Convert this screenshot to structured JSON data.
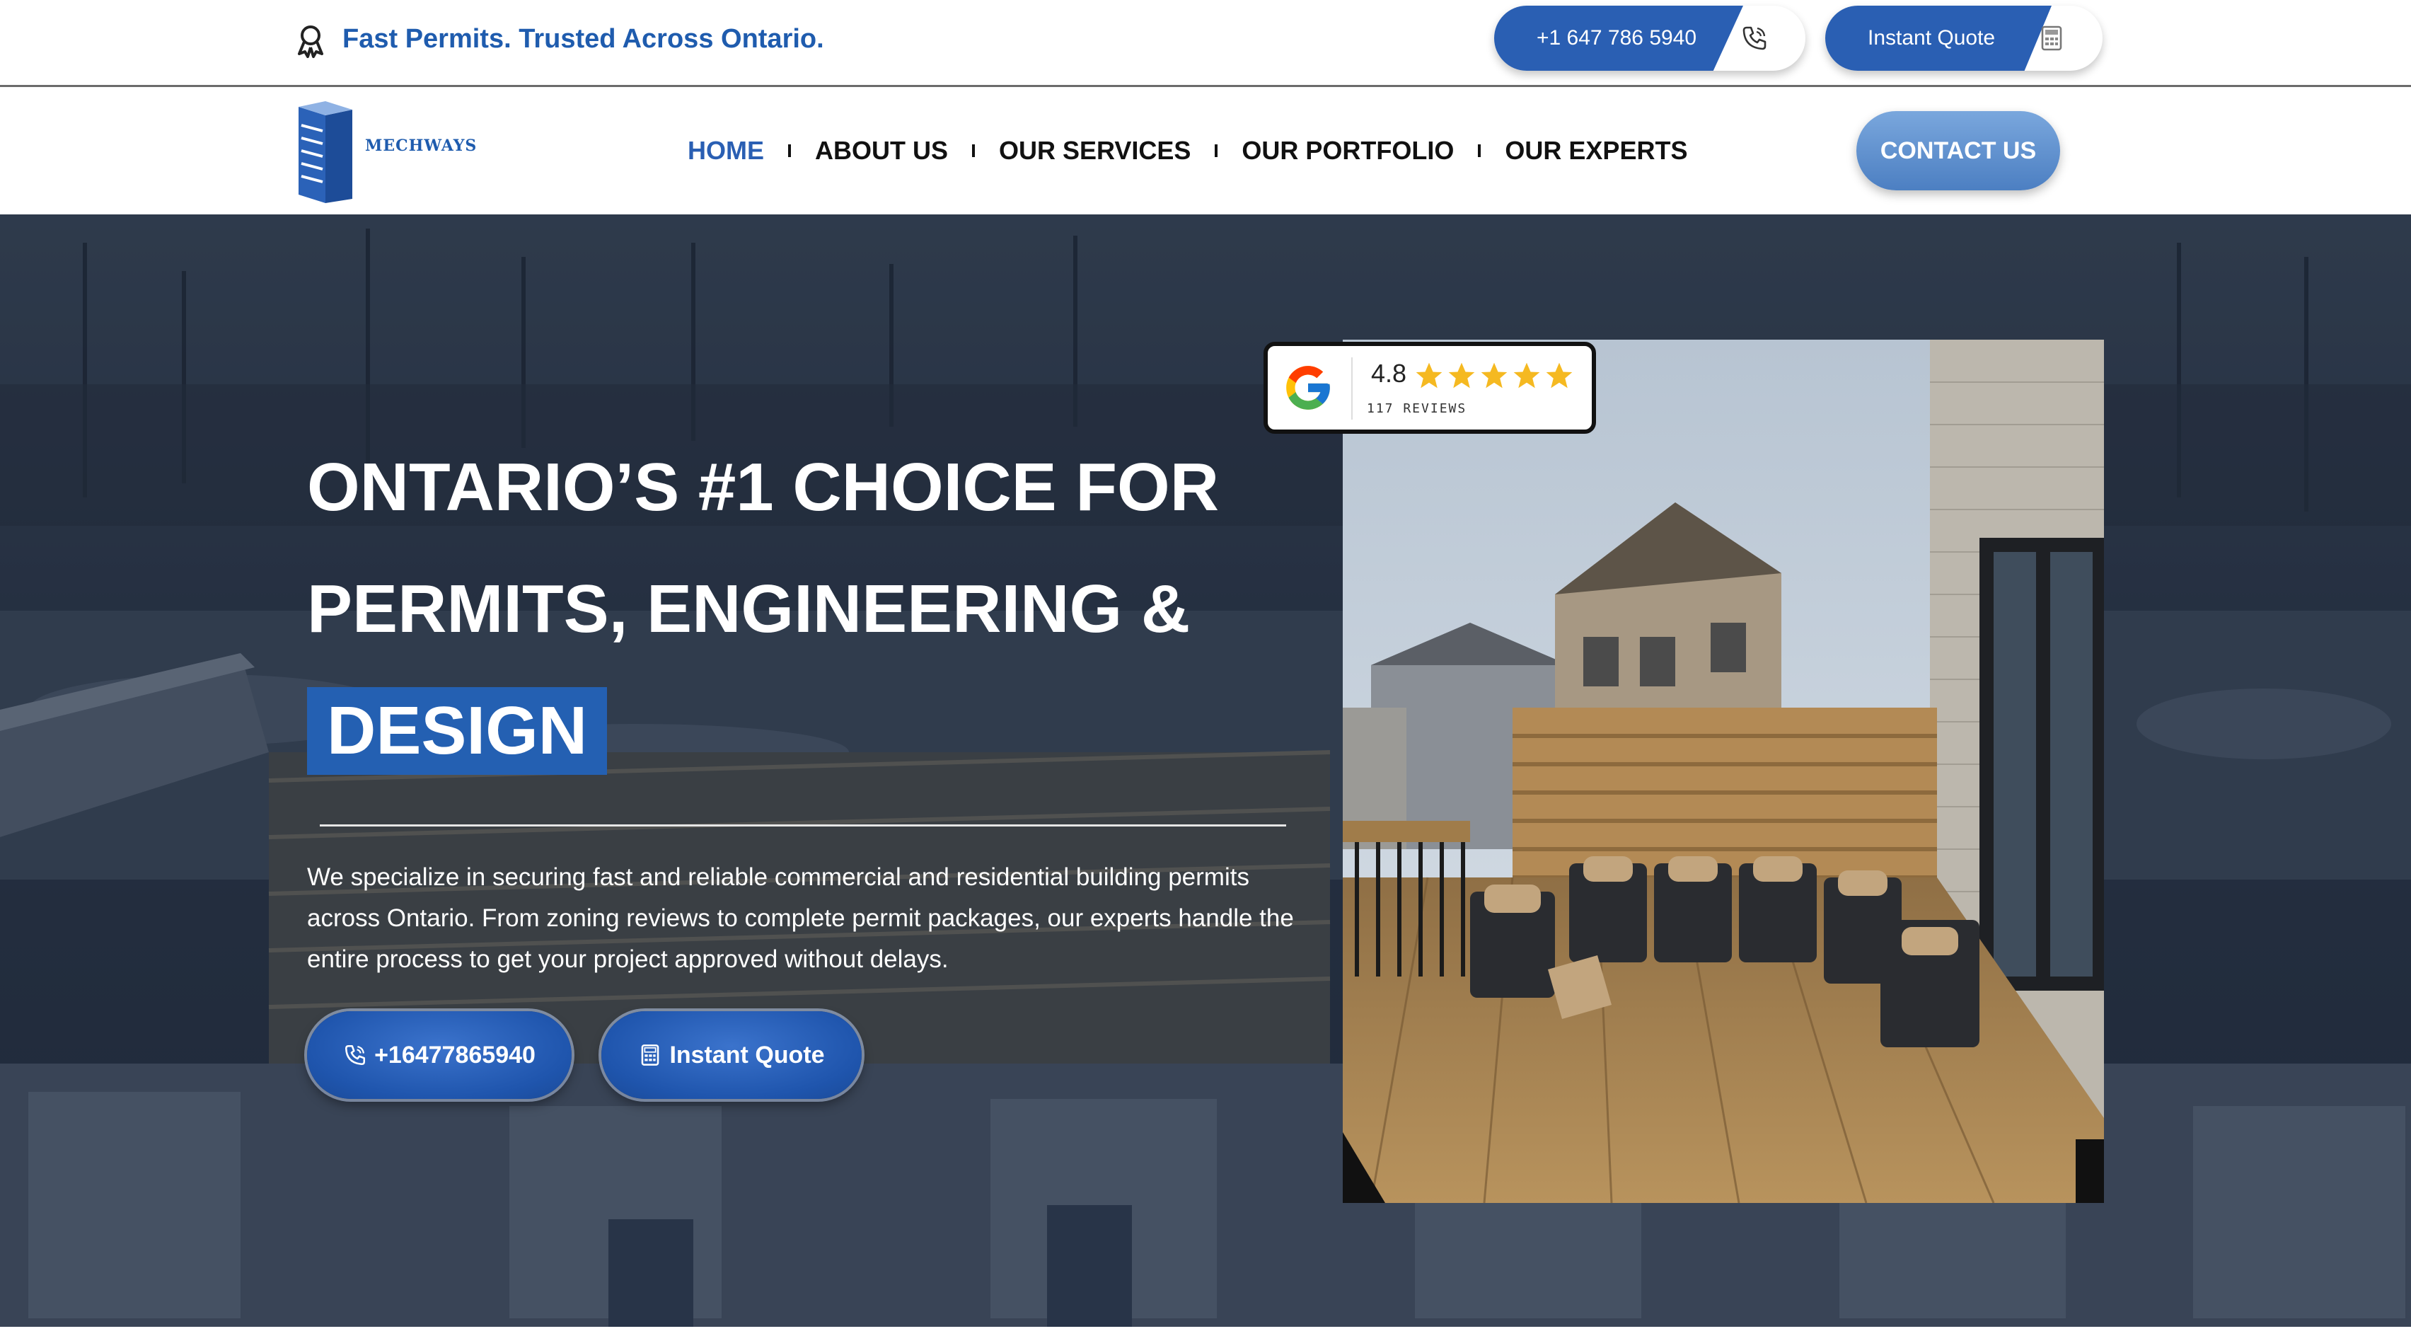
{
  "topbar": {
    "tagline": "Fast Permits. Trusted Across Ontario.",
    "tagline_icon": "award-ribbon-icon",
    "phone_label": "+1 647 786 5940",
    "phone_icon": "phone-icon",
    "quote_label": "Instant Quote",
    "quote_icon": "calculator-icon"
  },
  "nav": {
    "logo_text": "MECHWAYS",
    "items": [
      {
        "label": "HOME",
        "active": true
      },
      {
        "label": "ABOUT US",
        "active": false
      },
      {
        "label": "OUR SERVICES",
        "active": false
      },
      {
        "label": "OUR PORTFOLIO",
        "active": false
      },
      {
        "label": "OUR EXPERTS",
        "active": false
      }
    ],
    "contact_label": "CONTACT US"
  },
  "hero": {
    "title_line1": "ONTARIO’S #1 CHOICE FOR",
    "title_line2": "PERMITS, ENGINEERING &",
    "title_highlight": "DESIGN",
    "description": "We specialize in securing fast and reliable commercial and residential building permits across Ontario. From zoning reviews to complete permit packages, our experts handle the entire process to get your project approved without delays.",
    "phone_button": "+16477865940",
    "quote_button": "Instant Quote"
  },
  "rating": {
    "score": "4.8",
    "reviews": "117 REVIEWS",
    "stars": 5
  },
  "colors": {
    "brand_blue": "#2a5fb3",
    "tagline_blue": "#1f5cae",
    "contact_blue": "#5f91cf",
    "star_yellow": "#f5b921"
  }
}
